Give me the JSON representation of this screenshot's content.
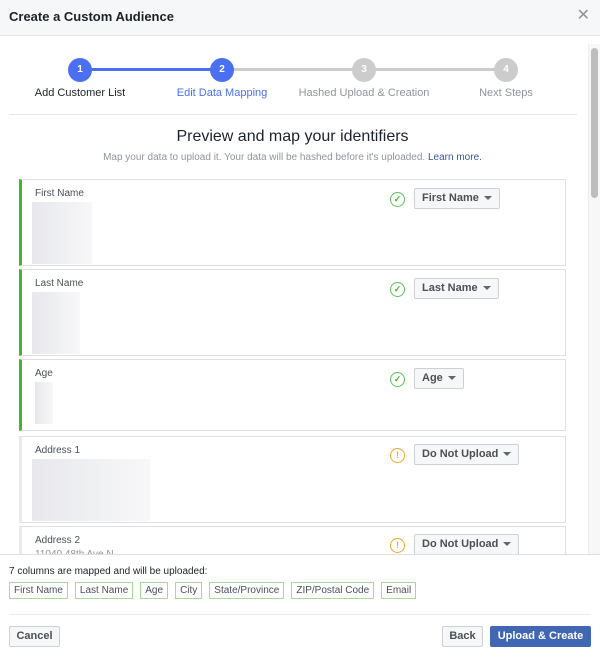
{
  "dialog": {
    "title": "Create a Custom Audience",
    "close_icon": "close-icon"
  },
  "stepper": {
    "steps": [
      {
        "number": "1",
        "label": "Add Customer List",
        "state": "complete"
      },
      {
        "number": "2",
        "label": "Edit Data Mapping",
        "state": "active"
      },
      {
        "number": "3",
        "label": "Hashed Upload & Creation",
        "state": "pending"
      },
      {
        "number": "4",
        "label": "Next Steps",
        "state": "pending"
      }
    ]
  },
  "main": {
    "heading": "Preview and map your identifiers",
    "subheading": "Map your data to upload it. Your data will be hashed before it's uploaded.",
    "learn_more": "Learn more."
  },
  "columns": [
    {
      "name": "First Name",
      "status": "mapped",
      "status_icon": "check-circle-icon",
      "mapping": "First Name"
    },
    {
      "name": "Last Name",
      "status": "mapped",
      "status_icon": "check-circle-icon",
      "mapping": "Last Name"
    },
    {
      "name": "Age",
      "status": "mapped",
      "status_icon": "check-circle-icon",
      "mapping": "Age"
    },
    {
      "name": "Address 1",
      "status": "warning",
      "status_icon": "warning-circle-icon",
      "mapping": "Do Not Upload"
    },
    {
      "name": "Address 2",
      "status": "warning",
      "status_icon": "warning-circle-icon",
      "mapping": "Do Not Upload",
      "preview": "11040 48th Ave N"
    }
  ],
  "summary": {
    "text": "7 columns are mapped and will be uploaded:",
    "tags": [
      "First Name",
      "Last Name",
      "Age",
      "City",
      "State/Province",
      "ZIP/Postal Code",
      "Email"
    ]
  },
  "actions": {
    "cancel": "Cancel",
    "back": "Back",
    "upload": "Upload & Create"
  },
  "colors": {
    "accent": "#4267b2",
    "step_active": "#4a6ff0",
    "step_pending": "#cccccc",
    "mapped": "#42b72a",
    "warning": "#f5a623"
  }
}
